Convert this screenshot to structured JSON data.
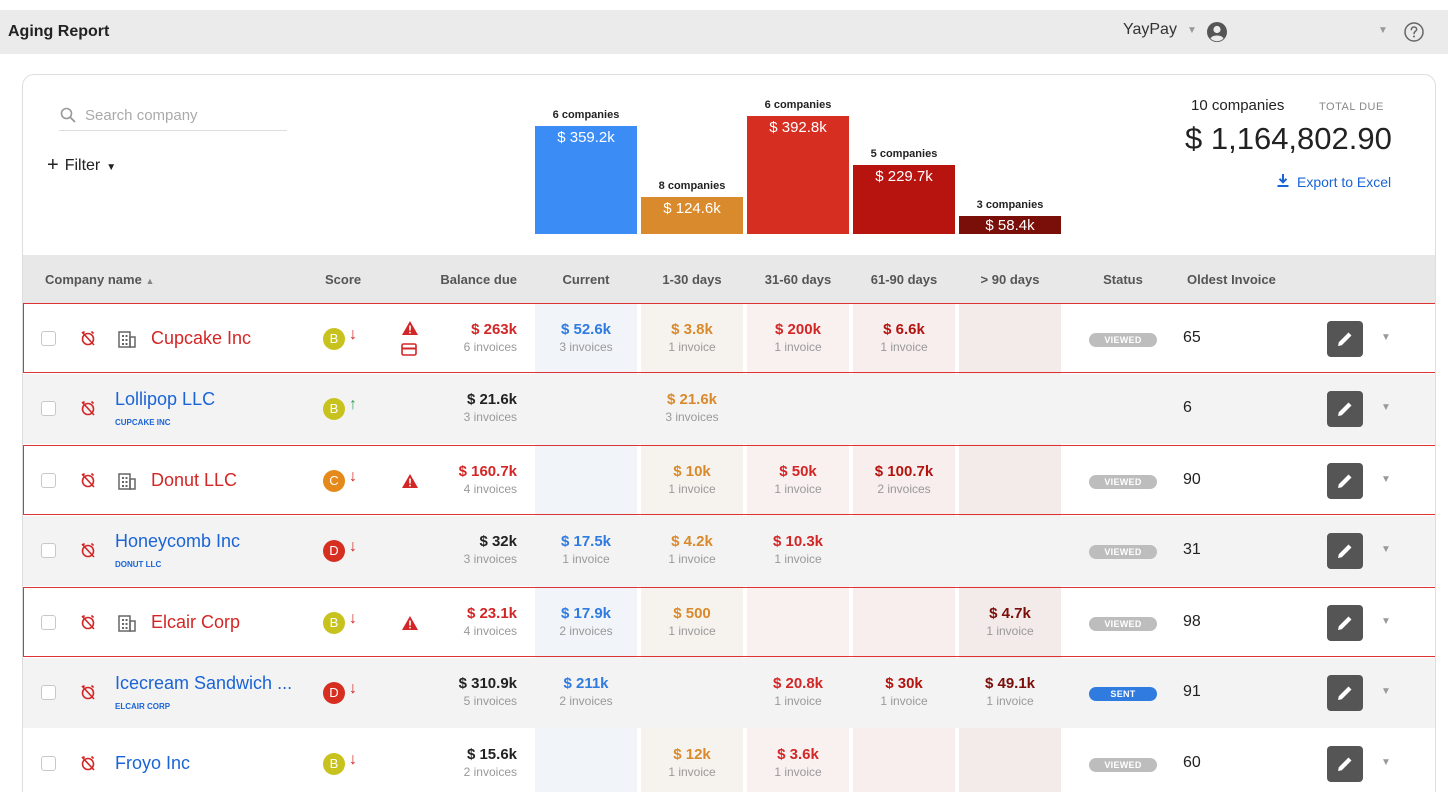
{
  "header": {
    "title": "Aging Report",
    "org": "YayPay"
  },
  "search": {
    "placeholder": "Search company"
  },
  "filter": {
    "label": "Filter"
  },
  "chart_data": {
    "type": "bar",
    "categories": [
      "Current",
      "1-30 days",
      "31-60 days",
      "61-90 days",
      "> 90 days"
    ],
    "values": [
      359.2,
      124.6,
      392.8,
      229.7,
      58.4
    ],
    "data_labels": [
      "$ 359.2k",
      "$ 124.6k",
      "$ 392.8k",
      "$ 229.7k",
      "$ 58.4k"
    ],
    "captions": [
      "6 companies",
      "8 companies",
      "6 companies",
      "5 companies",
      "3 companies"
    ],
    "colors": [
      "#3b8cf5",
      "#d98a2c",
      "#d62f22",
      "#b8140f",
      "#7a0f0a"
    ],
    "ylim": [
      0,
      392.8
    ]
  },
  "summary": {
    "companies": "10 companies",
    "total_label": "TOTAL DUE",
    "total": "$ 1,164,802.90",
    "export": "Export to Excel"
  },
  "columns": {
    "company": "Company name",
    "score": "Score",
    "balance": "Balance due",
    "current": "Current",
    "d1_30": "1-30 days",
    "d31_60": "31-60 days",
    "d61_90": "61-90 days",
    "d90": "> 90 days",
    "status": "Status",
    "oldest": "Oldest Invoice"
  },
  "colors": {
    "current": "#2f7be0",
    "d1_30": "#d98a2c",
    "d31_60": "#d32626",
    "d61_90": "#b3140f",
    "d90": "#7a0f0a",
    "badge_viewed": "#bdbdbd",
    "badge_sent": "#2f7be0",
    "score_B": "#c8c21e",
    "score_C": "#e58a1a",
    "score_D": "#d62f22"
  },
  "rows": [
    {
      "name": "Cupcake Inc",
      "parent": "",
      "name_color": "red",
      "building": true,
      "highlight": true,
      "score": "B",
      "trend": "down",
      "warn": true,
      "card": true,
      "balance": "$ 263k",
      "balance_sub": "6 invoices",
      "balance_color": "red",
      "current": "$ 52.6k",
      "current_sub": "3 invoices",
      "d1_30": "$ 3.8k",
      "d1_30_sub": "1 invoice",
      "d31_60": "$ 200k",
      "d31_60_sub": "1 invoice",
      "d61_90": "$ 6.6k",
      "d61_90_sub": "1 invoice",
      "d90": "",
      "d90_sub": "",
      "status": "VIEWED",
      "oldest": "65"
    },
    {
      "name": "Lollipop LLC",
      "parent": "CUPCAKE INC",
      "name_color": "blue",
      "building": false,
      "highlight": false,
      "score": "B",
      "trend": "up",
      "warn": false,
      "card": false,
      "balance": "$ 21.6k",
      "balance_sub": "3 invoices",
      "balance_color": "black",
      "current": "",
      "current_sub": "",
      "d1_30": "$ 21.6k",
      "d1_30_sub": "3 invoices",
      "d31_60": "",
      "d31_60_sub": "",
      "d61_90": "",
      "d61_90_sub": "",
      "d90": "",
      "d90_sub": "",
      "status": "",
      "oldest": "6"
    },
    {
      "name": "Donut LLC",
      "parent": "",
      "name_color": "red",
      "building": true,
      "highlight": true,
      "score": "C",
      "trend": "down",
      "warn": true,
      "card": false,
      "balance": "$ 160.7k",
      "balance_sub": "4 invoices",
      "balance_color": "red",
      "current": "",
      "current_sub": "",
      "d1_30": "$ 10k",
      "d1_30_sub": "1 invoice",
      "d31_60": "$ 50k",
      "d31_60_sub": "1 invoice",
      "d61_90": "$ 100.7k",
      "d61_90_sub": "2 invoices",
      "d90": "",
      "d90_sub": "",
      "status": "VIEWED",
      "oldest": "90"
    },
    {
      "name": "Honeycomb Inc",
      "parent": "DONUT LLC",
      "name_color": "blue",
      "building": false,
      "highlight": false,
      "score": "D",
      "trend": "down",
      "warn": false,
      "card": false,
      "balance": "$ 32k",
      "balance_sub": "3 invoices",
      "balance_color": "black",
      "current": "$ 17.5k",
      "current_sub": "1 invoice",
      "d1_30": "$ 4.2k",
      "d1_30_sub": "1 invoice",
      "d31_60": "$ 10.3k",
      "d31_60_sub": "1 invoice",
      "d61_90": "",
      "d61_90_sub": "",
      "d90": "",
      "d90_sub": "",
      "status": "VIEWED",
      "oldest": "31"
    },
    {
      "name": "Elcair Corp",
      "parent": "",
      "name_color": "red",
      "building": true,
      "highlight": true,
      "score": "B",
      "trend": "down",
      "warn": true,
      "card": false,
      "balance": "$ 23.1k",
      "balance_sub": "4 invoices",
      "balance_color": "red",
      "current": "$ 17.9k",
      "current_sub": "2 invoices",
      "d1_30": "$ 500",
      "d1_30_sub": "1 invoice",
      "d31_60": "",
      "d31_60_sub": "",
      "d61_90": "",
      "d61_90_sub": "",
      "d90": "$ 4.7k",
      "d90_sub": "1 invoice",
      "status": "VIEWED",
      "oldest": "98"
    },
    {
      "name": "Icecream Sandwich ...",
      "parent": "ELCAIR CORP",
      "name_color": "blue",
      "building": false,
      "highlight": false,
      "score": "D",
      "trend": "down",
      "warn": false,
      "card": false,
      "balance": "$ 310.9k",
      "balance_sub": "5 invoices",
      "balance_color": "black",
      "current": "$ 211k",
      "current_sub": "2 invoices",
      "d1_30": "",
      "d1_30_sub": "",
      "d31_60": "$ 20.8k",
      "d31_60_sub": "1 invoice",
      "d61_90": "$ 30k",
      "d61_90_sub": "1 invoice",
      "d90": "$ 49.1k",
      "d90_sub": "1 invoice",
      "status": "SENT",
      "oldest": "91"
    },
    {
      "name": "Froyo Inc",
      "parent": "",
      "name_color": "blue",
      "building": false,
      "highlight": false,
      "score": "B",
      "trend": "down",
      "warn": false,
      "card": false,
      "balance": "$ 15.6k",
      "balance_sub": "2 invoices",
      "balance_color": "black",
      "current": "",
      "current_sub": "",
      "d1_30": "$ 12k",
      "d1_30_sub": "1 invoice",
      "d31_60": "$ 3.6k",
      "d31_60_sub": "1 invoice",
      "d61_90": "",
      "d61_90_sub": "",
      "d90": "",
      "d90_sub": "",
      "status": "VIEWED",
      "oldest": "60"
    }
  ]
}
